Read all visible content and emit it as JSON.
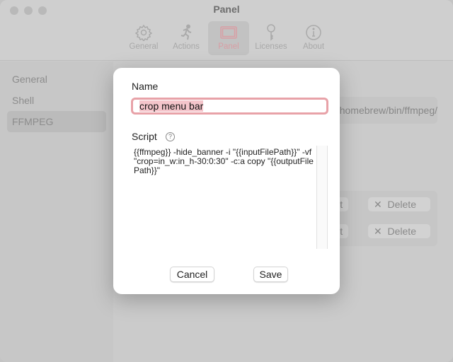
{
  "window": {
    "title": "Panel"
  },
  "toolbar": {
    "tabs": [
      {
        "label": "General",
        "icon": "gear-icon"
      },
      {
        "label": "Actions",
        "icon": "running-figure-icon"
      },
      {
        "label": "Panel",
        "icon": "panel-icon",
        "active": true
      },
      {
        "label": "Licenses",
        "icon": "key-icon"
      },
      {
        "label": "About",
        "icon": "info-icon"
      }
    ]
  },
  "sidebar": {
    "items": [
      {
        "label": "General"
      },
      {
        "label": "Shell"
      },
      {
        "label": "FFMPEG",
        "active": true
      }
    ]
  },
  "main": {
    "ffmpeg_path": "/opt/homebrew/bin/ffmpeg",
    "rows": [
      {
        "edit": "Edit",
        "delete": "Delete"
      },
      {
        "edit": "Edit",
        "delete": "Delete"
      }
    ]
  },
  "sheet": {
    "name_label": "Name",
    "name_value": "crop menu bar",
    "script_label": "Script",
    "help": "?",
    "script_value": "{{ffmpeg}} -hide_banner -i \"{{inputFilePath}}\" -vf \"crop=in_w:in_h-30:0:30\" -c:a copy \"{{outputFilePath}}\"",
    "cancel": "Cancel",
    "save": "Save"
  },
  "colors": {
    "accent": "#e8a2a8",
    "selection": "#f4c5cb"
  }
}
